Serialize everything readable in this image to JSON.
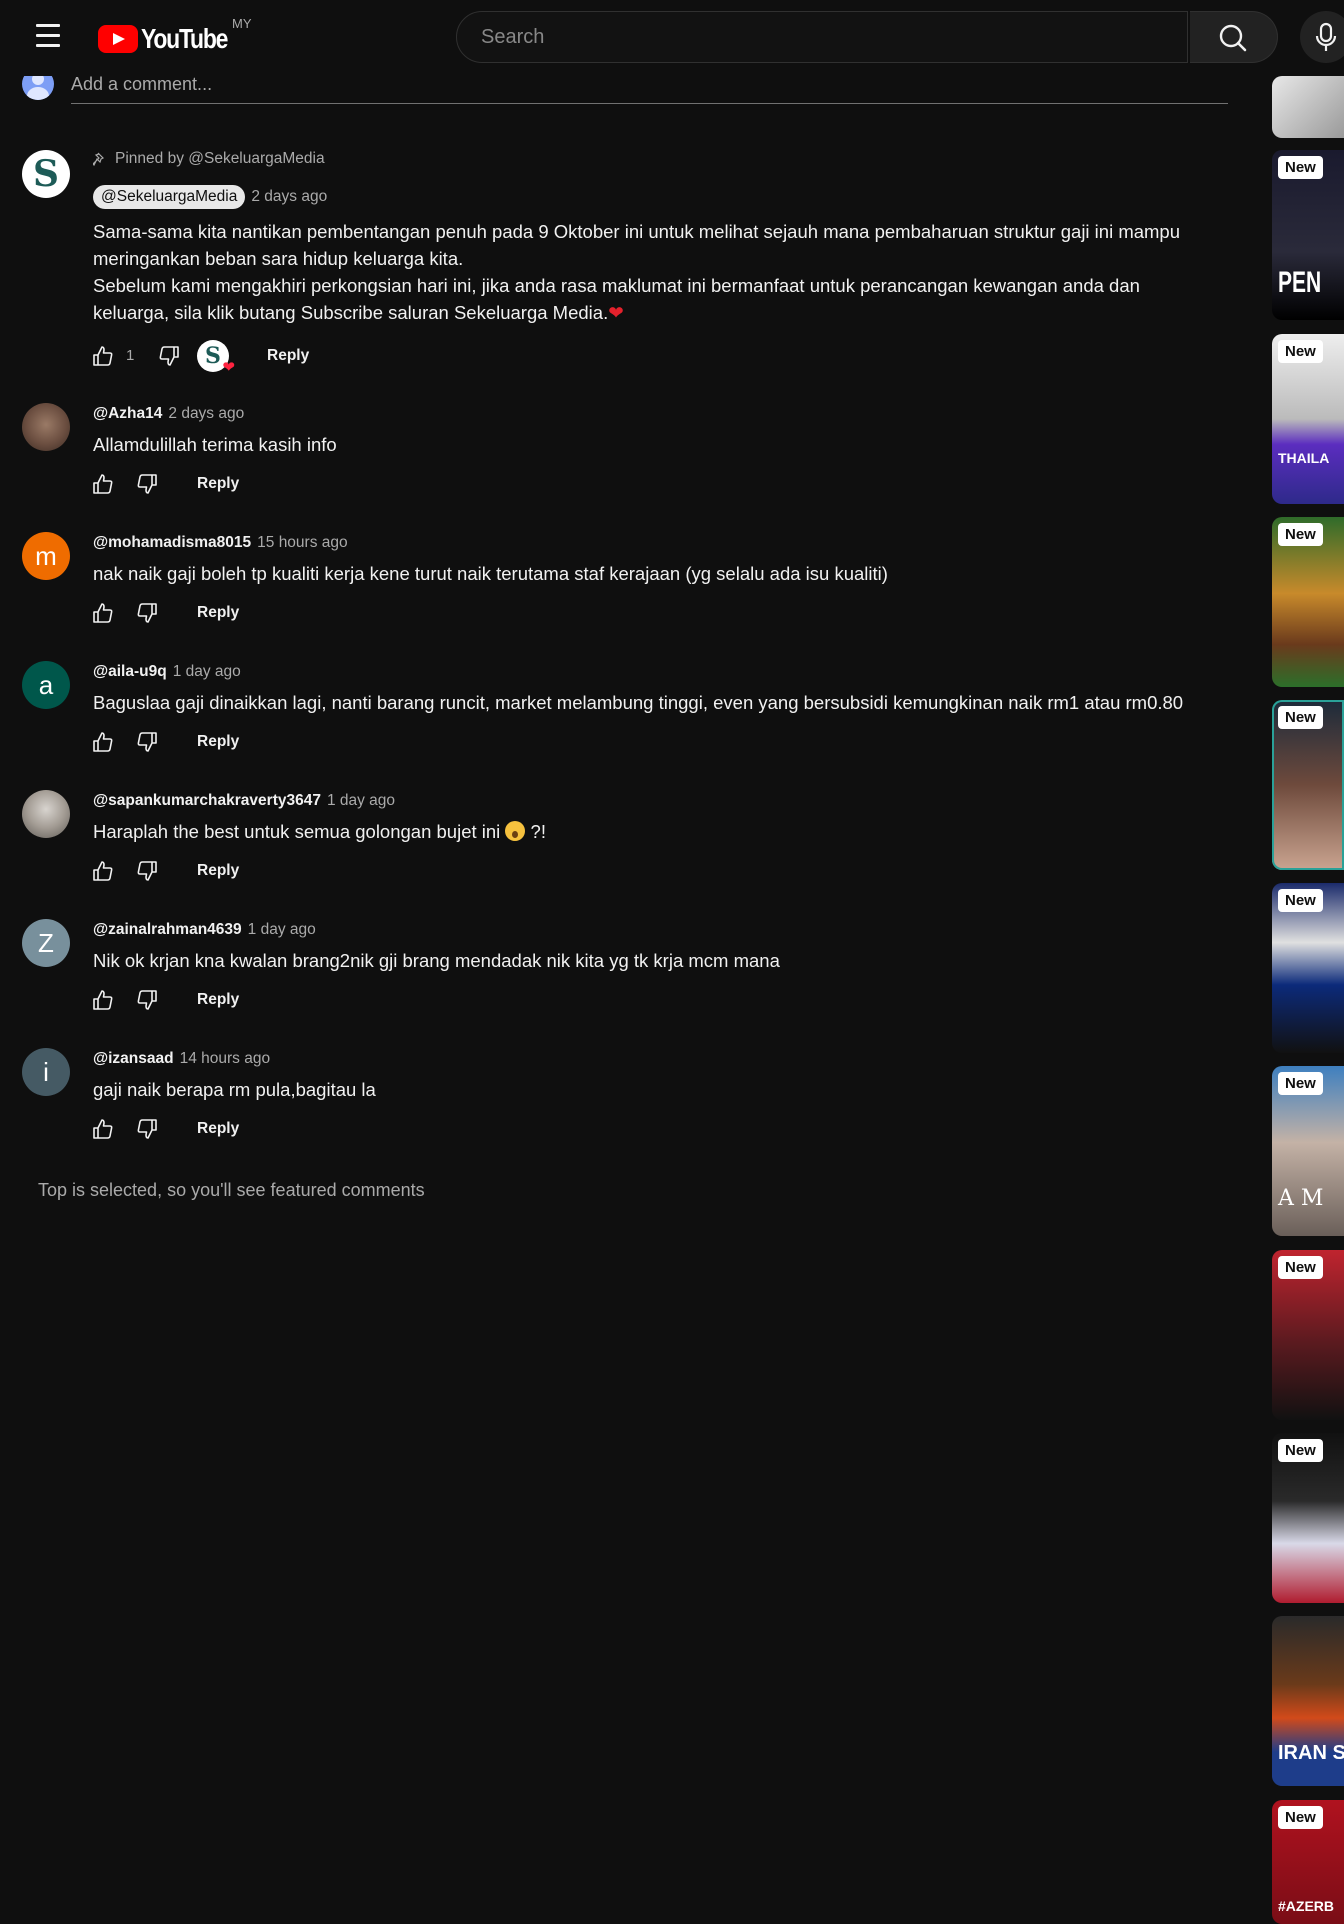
{
  "header": {
    "brand": "YouTube",
    "country": "MY",
    "search_placeholder": "Search"
  },
  "add_comment": {
    "placeholder": "Add a comment..."
  },
  "pinned": {
    "label": "Pinned by @SekeluargaMedia",
    "author": "@SekeluargaMedia",
    "time": "2 days ago",
    "line1": "Sama-sama kita nantikan pembentangan penuh pada 9 Oktober ini untuk melihat sejauh mana pembaharuan struktur gaji ini mampu",
    "line2": "meringankan beban sara hidup keluarga kita.",
    "line3": "Sebelum kami mengakhiri perkongsian hari ini, jika anda rasa maklumat ini bermanfaat untuk perancangan kewangan anda dan",
    "line4": "keluarga, sila klik butang Subscribe saluran Sekeluarga Media.",
    "likes": "1",
    "reply": "Reply",
    "avatar_letter": "S"
  },
  "comments": [
    {
      "author": "@Azha14",
      "time": "2 days ago",
      "text": "Allamdulillah terima kasih info",
      "reply": "Reply",
      "avatar_letter": ""
    },
    {
      "author": "@mohamadisma8015",
      "time": "15 hours ago",
      "text": "nak naik gaji boleh tp kualiti kerja kene turut naik terutama staf kerajaan (yg selalu ada isu kualiti)",
      "reply": "Reply",
      "avatar_letter": "m"
    },
    {
      "author": "@aila-u9q",
      "time": "1 day ago",
      "text": "Baguslaa gaji dinaikkan lagi, nanti barang runcit, market melambung tinggi, even yang bersubsidi kemungkinan naik rm1 atau rm0.80",
      "reply": "Reply",
      "avatar_letter": "a"
    },
    {
      "author": "@sapankumarchakraverty3647",
      "time": "1 day ago",
      "text": "Haraplah the best untuk semua golongan bujet ini",
      "text_suffix": " ?!",
      "reply": "Reply",
      "avatar_letter": ""
    },
    {
      "author": "@zainalrahman4639",
      "time": "1 day ago",
      "text": "Nik ok krjan kna kwalan brang2nik gji brang mendadak nik kita yg tk krja mcm mana",
      "reply": "Reply",
      "avatar_letter": "Z"
    },
    {
      "author": "@izansaad",
      "time": "14 hours ago",
      "text": "gaji naik berapa rm pula,bagitau la",
      "reply": "Reply",
      "avatar_letter": "i"
    }
  ],
  "footer_note": "Top is selected, so you'll see featured comments",
  "thumbnails": [
    {
      "badge": "",
      "caption": ""
    },
    {
      "badge": "New",
      "caption": "PEN"
    },
    {
      "badge": "New",
      "caption": "THAILA"
    },
    {
      "badge": "New",
      "caption": ""
    },
    {
      "badge": "New",
      "caption": ""
    },
    {
      "badge": "New",
      "caption": ""
    },
    {
      "badge": "New",
      "caption": "A M"
    },
    {
      "badge": "New",
      "caption": ""
    },
    {
      "badge": "New",
      "caption": ""
    },
    {
      "badge": "",
      "caption": "IRAN S"
    },
    {
      "badge": "New",
      "caption": "#AZERB"
    }
  ],
  "colors": {
    "background": "#0f0f0f",
    "brand_red": "#ff0000",
    "avatar_orange": "#ef6c00",
    "avatar_teal": "#00574b",
    "avatar_slate": "#78909c",
    "avatar_blue_grey": "#455a64"
  }
}
